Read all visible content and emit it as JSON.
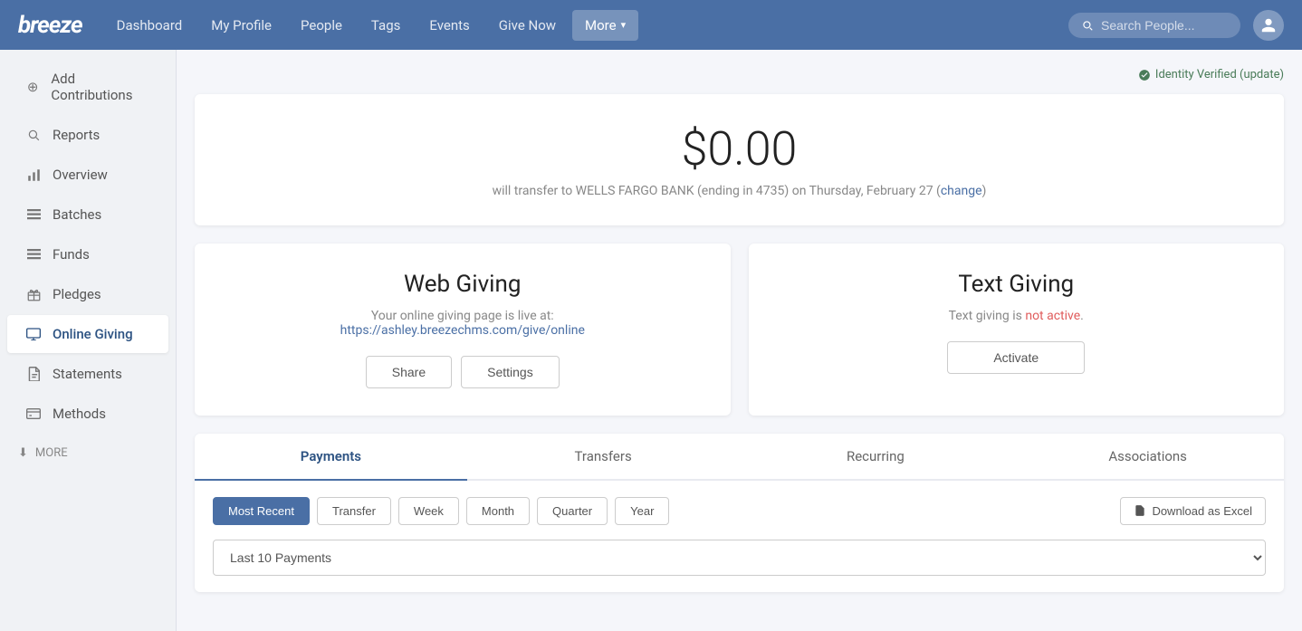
{
  "navbar": {
    "logo": "breeze",
    "links": [
      {
        "label": "Dashboard",
        "id": "dashboard"
      },
      {
        "label": "My Profile",
        "id": "my-profile"
      },
      {
        "label": "People",
        "id": "people"
      },
      {
        "label": "Tags",
        "id": "tags"
      },
      {
        "label": "Events",
        "id": "events"
      },
      {
        "label": "Give Now",
        "id": "give-now"
      },
      {
        "label": "More",
        "id": "more"
      }
    ],
    "search_placeholder": "Search People...",
    "more_label": "More"
  },
  "sidebar": {
    "items": [
      {
        "label": "Add Contributions",
        "id": "add-contributions",
        "icon": "➕"
      },
      {
        "label": "Reports",
        "id": "reports",
        "icon": "🔍"
      },
      {
        "label": "Overview",
        "id": "overview",
        "icon": "📊"
      },
      {
        "label": "Batches",
        "id": "batches",
        "icon": "≡"
      },
      {
        "label": "Funds",
        "id": "funds",
        "icon": "≡"
      },
      {
        "label": "Pledges",
        "id": "pledges",
        "icon": "🎁"
      },
      {
        "label": "Online Giving",
        "id": "online-giving",
        "icon": "💻",
        "active": true
      },
      {
        "label": "Statements",
        "id": "statements",
        "icon": "📄"
      },
      {
        "label": "Methods",
        "id": "methods",
        "icon": "💳"
      }
    ],
    "more_label": "MORE"
  },
  "identity": {
    "text": "Identity Verified (update)"
  },
  "balance": {
    "amount": "$0.00",
    "description": "will transfer to WELLS FARGO BANK (ending in 4735) on Thursday, February 27 (",
    "change_label": "change",
    "description_end": ")"
  },
  "web_giving": {
    "title": "Web Giving",
    "description": "Your online giving page is live at:",
    "url": "https://ashley.breezechms.com/give/online",
    "share_label": "Share",
    "settings_label": "Settings"
  },
  "text_giving": {
    "title": "Text Giving",
    "description_prefix": "Text giving is ",
    "not_active": "not active",
    "description_suffix": ".",
    "activate_label": "Activate"
  },
  "tabs": {
    "items": [
      {
        "label": "Payments",
        "id": "payments",
        "active": true
      },
      {
        "label": "Transfers",
        "id": "transfers"
      },
      {
        "label": "Recurring",
        "id": "recurring"
      },
      {
        "label": "Associations",
        "id": "associations"
      }
    ]
  },
  "filters": {
    "buttons": [
      {
        "label": "Most Recent",
        "id": "most-recent",
        "active": true
      },
      {
        "label": "Transfer",
        "id": "transfer"
      },
      {
        "label": "Week",
        "id": "week"
      },
      {
        "label": "Month",
        "id": "month"
      },
      {
        "label": "Quarter",
        "id": "quarter"
      },
      {
        "label": "Year",
        "id": "year"
      }
    ],
    "excel_label": "Download as Excel"
  },
  "payments_dropdown": {
    "options": [
      "Last 10 Payments"
    ],
    "selected": "Last 10 Payments"
  }
}
